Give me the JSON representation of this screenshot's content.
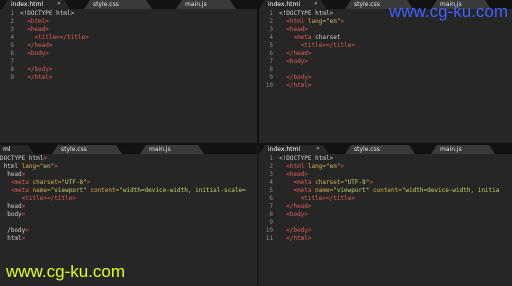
{
  "panes": [
    {
      "tabs": [
        {
          "label": "index.html",
          "active": true
        },
        {
          "label": "style.css",
          "active": false
        },
        {
          "label": "main.js",
          "active": false
        }
      ],
      "lines": [
        {
          "num": "1",
          "text": "<!DOCTYPE html>"
        },
        {
          "num": "2",
          "text": "  <html>"
        },
        {
          "num": "3",
          "text": "  <head>"
        },
        {
          "num": "4",
          "text": "    <title></title>"
        },
        {
          "num": "5",
          "text": "  </head>"
        },
        {
          "num": "6",
          "text": "  <body>"
        },
        {
          "num": "7",
          "text": ""
        },
        {
          "num": "8",
          "text": "  </body>"
        },
        {
          "num": "9",
          "text": "  </html>"
        }
      ]
    },
    {
      "tabs": [
        {
          "label": "index.html",
          "active": true
        },
        {
          "label": "style.css",
          "active": false
        },
        {
          "label": "main.js",
          "active": false
        }
      ],
      "lines": [
        {
          "num": "1",
          "text": "<!DOCTYPE html>"
        },
        {
          "num": "2",
          "text": "  <html lang=\"en\">"
        },
        {
          "num": "3",
          "text": "  <head>"
        },
        {
          "num": "4",
          "text": "    <meta charset"
        },
        {
          "num": "5",
          "text": "      <title></title>"
        },
        {
          "num": "6",
          "text": "  </head>"
        },
        {
          "num": "7",
          "text": "  <body>"
        },
        {
          "num": "8",
          "text": ""
        },
        {
          "num": "9",
          "text": "  </body>"
        },
        {
          "num": "10",
          "text": "  </html>"
        }
      ]
    },
    {
      "tabs": [
        {
          "label": "ml",
          "active": true
        },
        {
          "label": "style.css",
          "active": false
        },
        {
          "label": "main.js",
          "active": false
        }
      ],
      "lines": [
        {
          "num": "",
          "text": "DOCTYPE html>"
        },
        {
          "num": "",
          "text": " html lang=\"en\">"
        },
        {
          "num": "",
          "text": "  head>"
        },
        {
          "num": "",
          "text": "   <meta charset=\"UTF-8\">"
        },
        {
          "num": "",
          "text": "   <meta name=\"viewport\" content=\"width=device-width, initial-scale="
        },
        {
          "num": "",
          "text": "      <title></title>"
        },
        {
          "num": "",
          "text": "  head>"
        },
        {
          "num": "",
          "text": "  body>"
        },
        {
          "num": "",
          "text": ""
        },
        {
          "num": "",
          "text": "  /body>"
        },
        {
          "num": "",
          "text": "  html>"
        }
      ]
    },
    {
      "tabs": [
        {
          "label": "index.html",
          "active": true
        },
        {
          "label": "style.css",
          "active": false
        },
        {
          "label": "main.js",
          "active": false
        }
      ],
      "lines": [
        {
          "num": "1",
          "text": "<!DOCTYPE html>"
        },
        {
          "num": "2",
          "text": "  <html lang=\"en\">"
        },
        {
          "num": "3",
          "text": "  <head>"
        },
        {
          "num": "4",
          "text": "    <meta charset=\"UTF-8\">"
        },
        {
          "num": "5",
          "text": "    <meta name=\"viewport\" content=\"width=device-width, initia"
        },
        {
          "num": "6",
          "text": "      <title></title>"
        },
        {
          "num": "7",
          "text": "  </head>"
        },
        {
          "num": "8",
          "text": "  <body>"
        },
        {
          "num": "9",
          "text": ""
        },
        {
          "num": "10",
          "text": "  </body>"
        },
        {
          "num": "11",
          "text": "  </html>"
        }
      ]
    }
  ],
  "watermark_top": "www.cg-ku.com",
  "watermark_bottom": "www.cg-ku.com"
}
